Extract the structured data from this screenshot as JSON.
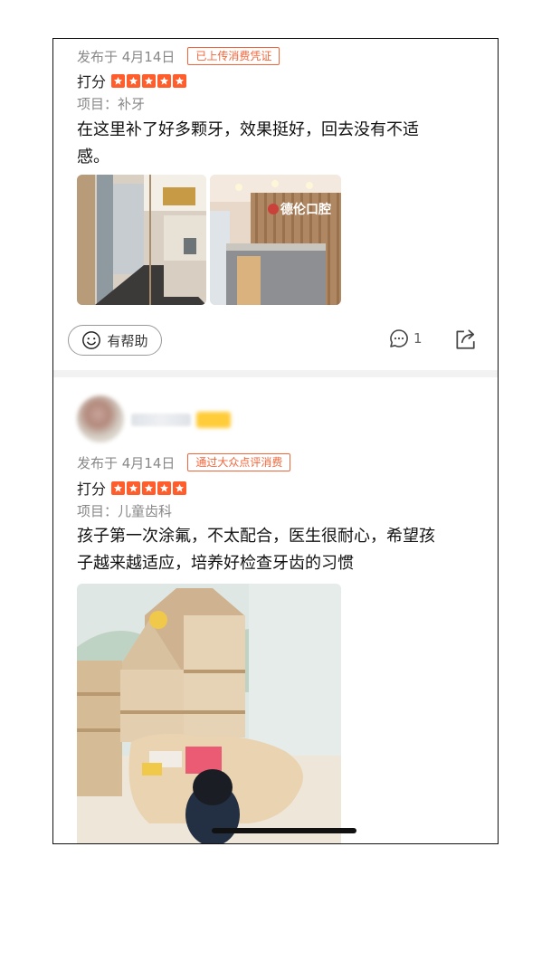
{
  "reviews": [
    {
      "date": "发布于 4月14日",
      "badge": "已上传消费凭证",
      "score_label": "打分",
      "stars": 5,
      "project": "项目：补牙",
      "text_line1": "在这里补了好多颗牙，效果挺好，回去没有不适",
      "text_line2": "感。",
      "photos": [
        "clinic-hallway-photo",
        "clinic-reception-photo"
      ],
      "photo_sign_text": "德伦口腔",
      "helpful_label": "有帮助",
      "comment_count": "1"
    },
    {
      "date": "发布于 4月14日",
      "badge": "通过大众点评消费",
      "score_label": "打分",
      "stars": 5,
      "project": "项目：儿童齿科",
      "text_line1": "孩子第一次涂氟，不太配合，医生很耐心，希望孩",
      "text_line2": "子越来越适应，培养好检查牙齿的习惯",
      "photos": [
        "kids-play-area-photo"
      ]
    }
  ],
  "colors": {
    "accent": "#f2653a",
    "star": "#ff5d2b",
    "muted_text": "#888888",
    "body_text": "#111111"
  }
}
